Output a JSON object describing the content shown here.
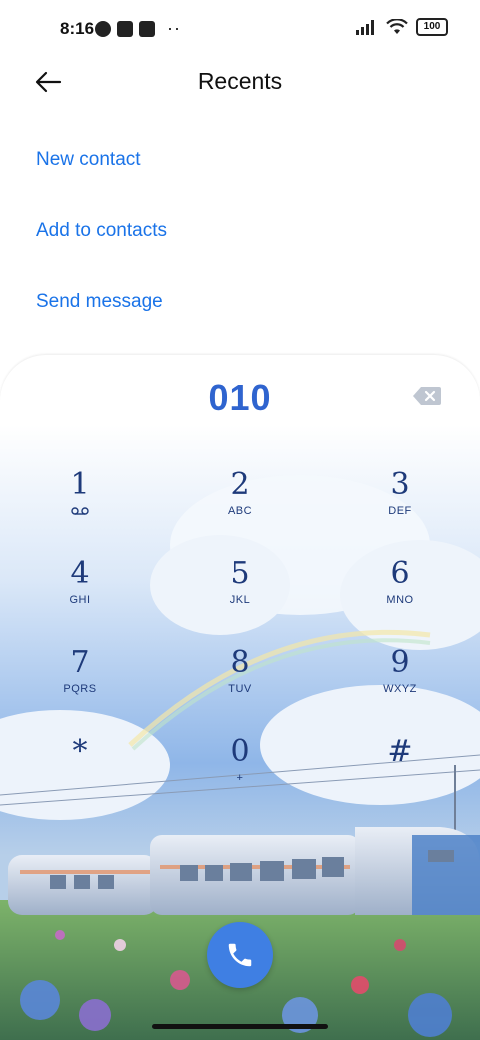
{
  "status": {
    "time": "8:16",
    "battery": "100"
  },
  "header": {
    "title": "Recents"
  },
  "actions": {
    "new_contact": "New contact",
    "add_to_contacts": "Add to contacts",
    "send_message": "Send message"
  },
  "dialer": {
    "number": "010",
    "keys": [
      {
        "digit": "1",
        "letters": ""
      },
      {
        "digit": "2",
        "letters": "ABC"
      },
      {
        "digit": "3",
        "letters": "DEF"
      },
      {
        "digit": "4",
        "letters": "GHI"
      },
      {
        "digit": "5",
        "letters": "JKL"
      },
      {
        "digit": "6",
        "letters": "MNO"
      },
      {
        "digit": "7",
        "letters": "PQRS"
      },
      {
        "digit": "8",
        "letters": "TUV"
      },
      {
        "digit": "9",
        "letters": "WXYZ"
      },
      {
        "digit": "*",
        "letters": ""
      },
      {
        "digit": "0",
        "letters": "+"
      },
      {
        "digit": "#",
        "letters": ""
      }
    ]
  },
  "icons": {
    "back": "arrow-left-icon",
    "delete": "backspace-icon",
    "call": "phone-icon",
    "voicemail": "voicemail-icon",
    "wifi": "wifi-icon",
    "signal": "signal-icon"
  },
  "colors": {
    "accent": "#1a73e8",
    "number": "#2f64cf",
    "call": "#3f7fe3",
    "key_text": "#1e3a7a"
  }
}
